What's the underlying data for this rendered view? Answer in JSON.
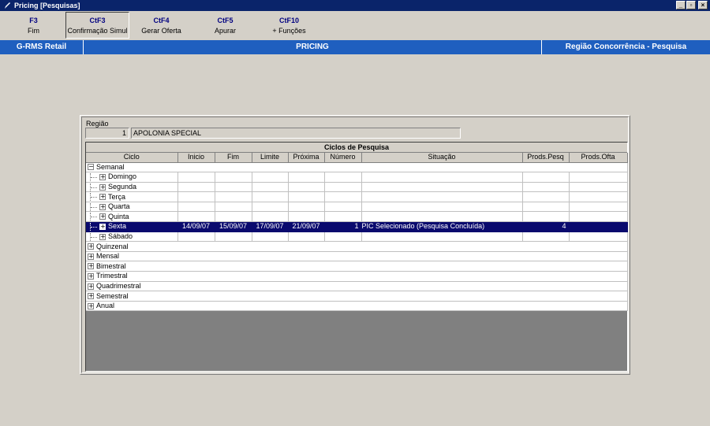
{
  "window": {
    "title": "Pricing [Pesquisas]",
    "controls": [
      "_",
      "▫",
      "×"
    ]
  },
  "toolbar": [
    {
      "key": "F3",
      "label": "Fim",
      "pressed": false
    },
    {
      "key": "CtF3",
      "label": "Confirmação Simul",
      "pressed": true
    },
    {
      "key": "CtF4",
      "label": "Gerar Oferta",
      "pressed": false
    },
    {
      "key": "CtF5",
      "label": "Apurar",
      "pressed": false
    },
    {
      "key": "CtF10",
      "label": "+ Funções",
      "pressed": false
    }
  ],
  "header": {
    "left": "G-RMS Retail",
    "center": "PRICING",
    "right": "Região Concorrência - Pesquisa"
  },
  "regiao": {
    "label": "Região",
    "code": "1",
    "name": "APOLONIA SPECIAL"
  },
  "grid": {
    "title": "Ciclos de Pesquisa",
    "columns": [
      "Ciclo",
      "Inicio",
      "Fim",
      "Limite",
      "Próxima",
      "Número",
      "Situação",
      "Prods.Pesq",
      "Prods.Ofta"
    ],
    "rows": [
      {
        "level": 0,
        "toggle": "−",
        "ciclo": "Semanal",
        "inicio": "",
        "fim": "",
        "limite": "",
        "proxima": "",
        "numero": "",
        "situacao": "",
        "pesq": "",
        "ofta": "",
        "selected": false,
        "cells": false
      },
      {
        "level": 1,
        "toggle": "+",
        "ciclo": "Domingo",
        "inicio": "",
        "fim": "",
        "limite": "",
        "proxima": "",
        "numero": "",
        "situacao": "",
        "pesq": "",
        "ofta": "",
        "selected": false,
        "cells": true
      },
      {
        "level": 1,
        "toggle": "+",
        "ciclo": "Segunda",
        "inicio": "",
        "fim": "",
        "limite": "",
        "proxima": "",
        "numero": "",
        "situacao": "",
        "pesq": "",
        "ofta": "",
        "selected": false,
        "cells": true
      },
      {
        "level": 1,
        "toggle": "+",
        "ciclo": "Terça",
        "inicio": "",
        "fim": "",
        "limite": "",
        "proxima": "",
        "numero": "",
        "situacao": "",
        "pesq": "",
        "ofta": "",
        "selected": false,
        "cells": true
      },
      {
        "level": 1,
        "toggle": "+",
        "ciclo": "Quarta",
        "inicio": "",
        "fim": "",
        "limite": "",
        "proxima": "",
        "numero": "",
        "situacao": "",
        "pesq": "",
        "ofta": "",
        "selected": false,
        "cells": true
      },
      {
        "level": 1,
        "toggle": "+",
        "ciclo": "Quinta",
        "inicio": "",
        "fim": "",
        "limite": "",
        "proxima": "",
        "numero": "",
        "situacao": "",
        "pesq": "",
        "ofta": "",
        "selected": false,
        "cells": true
      },
      {
        "level": 1,
        "toggle": "+",
        "ciclo": "Sexta",
        "inicio": "14/09/07",
        "fim": "15/09/07",
        "limite": "17/09/07",
        "proxima": "21/09/07",
        "numero": "1",
        "situacao": "PIC Selecionado (Pesquisa Concluída)",
        "pesq": "4",
        "ofta": "",
        "selected": true,
        "cells": true
      },
      {
        "level": 1,
        "toggle": "+",
        "ciclo": "Sábado",
        "inicio": "",
        "fim": "",
        "limite": "",
        "proxima": "",
        "numero": "",
        "situacao": "",
        "pesq": "",
        "ofta": "",
        "selected": false,
        "cells": true
      },
      {
        "level": 0,
        "toggle": "+",
        "ciclo": "Quinzenal",
        "selected": false,
        "cells": false
      },
      {
        "level": 0,
        "toggle": "+",
        "ciclo": "Mensal",
        "selected": false,
        "cells": false
      },
      {
        "level": 0,
        "toggle": "+",
        "ciclo": "Bimestral",
        "selected": false,
        "cells": false
      },
      {
        "level": 0,
        "toggle": "+",
        "ciclo": "Trimestral",
        "selected": false,
        "cells": false
      },
      {
        "level": 0,
        "toggle": "+",
        "ciclo": "Quadrimestral",
        "selected": false,
        "cells": false
      },
      {
        "level": 0,
        "toggle": "+",
        "ciclo": "Semestral",
        "selected": false,
        "cells": false
      },
      {
        "level": 0,
        "toggle": "+",
        "ciclo": "Anual",
        "selected": false,
        "cells": false
      }
    ]
  },
  "colors": {
    "titlebar": "#0a246a",
    "header": "#1f5fbf",
    "selection": "#0a0a6e",
    "face": "#d4d0c8",
    "empty_grid": "#808080"
  }
}
